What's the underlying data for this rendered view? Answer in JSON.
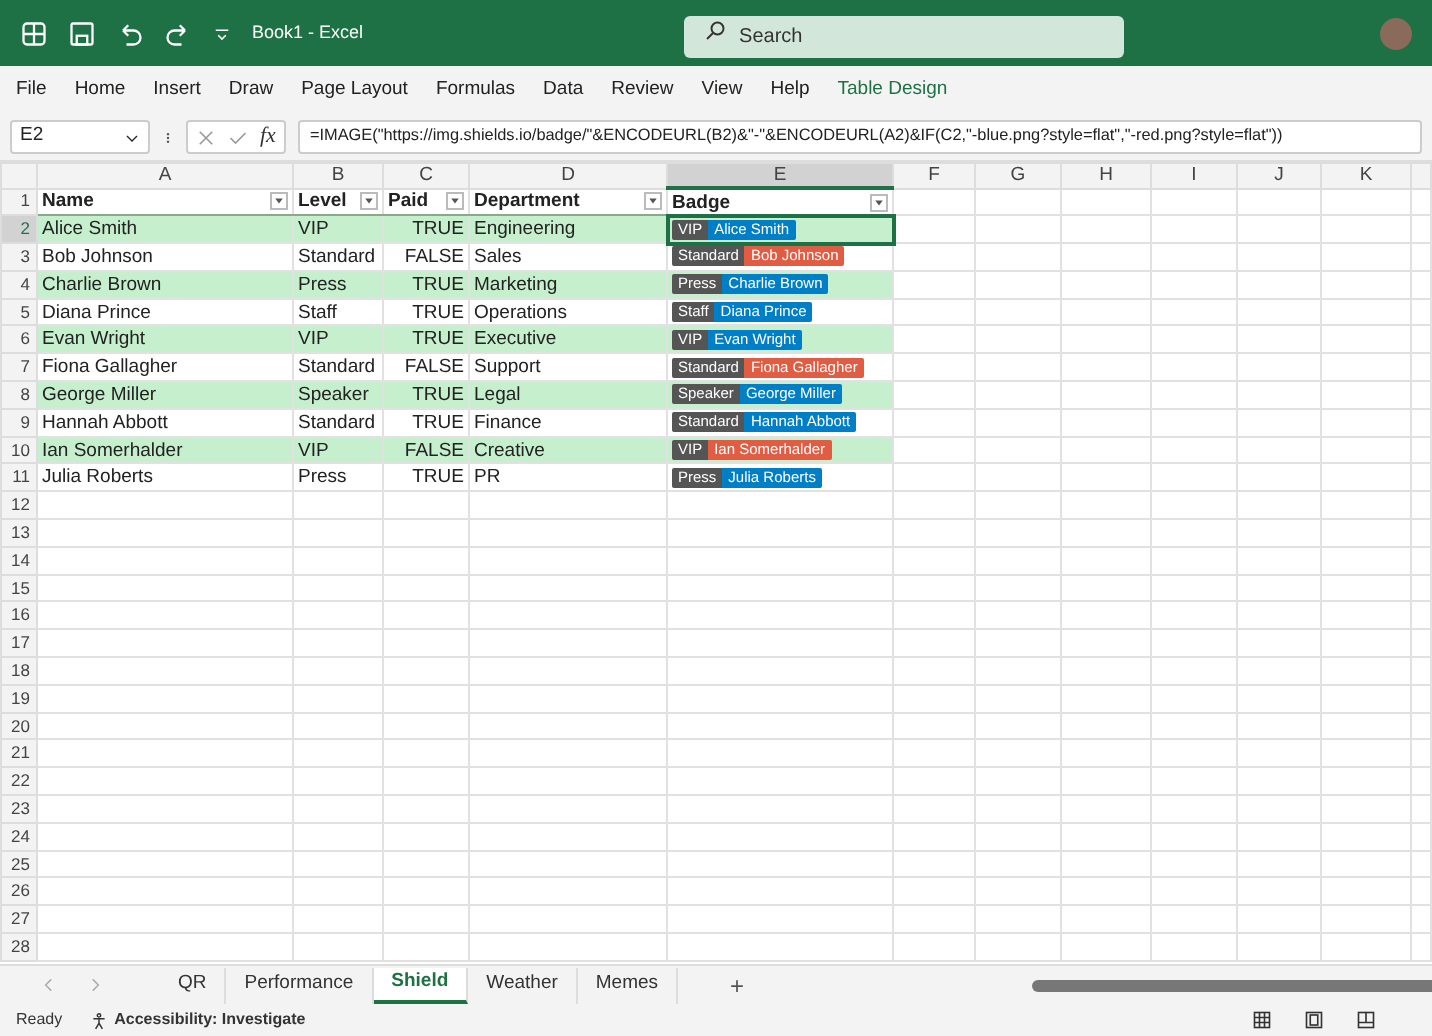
{
  "window": {
    "title": "Book1  -  Excel",
    "search": {
      "placeholder": "Search"
    }
  },
  "ribbon_tabs": [
    {
      "label": "File",
      "kind": "normal"
    },
    {
      "label": "Home",
      "kind": "normal"
    },
    {
      "label": "Insert",
      "kind": "normal"
    },
    {
      "label": "Draw",
      "kind": "normal"
    },
    {
      "label": "Page Layout",
      "kind": "normal"
    },
    {
      "label": "Formulas",
      "kind": "normal"
    },
    {
      "label": "Data",
      "kind": "normal"
    },
    {
      "label": "Review",
      "kind": "normal"
    },
    {
      "label": "View",
      "kind": "normal"
    },
    {
      "label": "Help",
      "kind": "normal"
    },
    {
      "label": "Table Design",
      "kind": "contextual"
    }
  ],
  "formula_bar": {
    "name_box": "E2",
    "fx": "fx",
    "formula": "=IMAGE(\"https://img.shields.io/badge/\"&ENCODEURL(B2)&\"-\"&ENCODEURL(A2)&IF(C2,\"-blue.png?style=flat\",\"-red.png?style=flat\"))"
  },
  "column_headers": [
    {
      "label": "A",
      "selected": false
    },
    {
      "label": "B",
      "selected": false
    },
    {
      "label": "C",
      "selected": false
    },
    {
      "label": "D",
      "selected": false
    },
    {
      "label": "E",
      "selected": true
    },
    {
      "label": "F",
      "selected": false
    },
    {
      "label": "G",
      "selected": false
    },
    {
      "label": "H",
      "selected": false
    },
    {
      "label": "I",
      "selected": false
    },
    {
      "label": "J",
      "selected": false
    },
    {
      "label": "K",
      "selected": false
    }
  ],
  "row_numbers": [
    {
      "label": "1",
      "selected": false
    },
    {
      "label": "2",
      "selected": true
    },
    {
      "label": "3",
      "selected": false
    },
    {
      "label": "4",
      "selected": false
    },
    {
      "label": "5",
      "selected": false
    },
    {
      "label": "6",
      "selected": false
    },
    {
      "label": "7",
      "selected": false
    },
    {
      "label": "8",
      "selected": false
    },
    {
      "label": "9",
      "selected": false
    },
    {
      "label": "10",
      "selected": false
    },
    {
      "label": "11",
      "selected": false
    },
    {
      "label": "12",
      "selected": false
    },
    {
      "label": "13",
      "selected": false
    },
    {
      "label": "14",
      "selected": false
    },
    {
      "label": "15",
      "selected": false
    },
    {
      "label": "16",
      "selected": false
    },
    {
      "label": "17",
      "selected": false
    },
    {
      "label": "18",
      "selected": false
    },
    {
      "label": "19",
      "selected": false
    },
    {
      "label": "20",
      "selected": false
    },
    {
      "label": "21",
      "selected": false
    },
    {
      "label": "22",
      "selected": false
    },
    {
      "label": "23",
      "selected": false
    },
    {
      "label": "24",
      "selected": false
    },
    {
      "label": "25",
      "selected": false
    },
    {
      "label": "26",
      "selected": false
    },
    {
      "label": "27",
      "selected": false
    },
    {
      "label": "28",
      "selected": false
    }
  ],
  "table": {
    "columns": [
      "Name",
      "Level",
      "Paid",
      "Department",
      "Badge"
    ],
    "rows": [
      {
        "name": "Alice Smith",
        "level": "VIP",
        "paid": "TRUE",
        "department": "Engineering",
        "badge": {
          "label": "VIP",
          "message": "Alice Smith",
          "color": "#007ec6"
        }
      },
      {
        "name": "Bob Johnson",
        "level": "Standard",
        "paid": "FALSE",
        "department": "Sales",
        "badge": {
          "label": "Standard",
          "message": "Bob Johnson",
          "color": "#e05d44"
        }
      },
      {
        "name": "Charlie Brown",
        "level": "Press",
        "paid": "TRUE",
        "department": "Marketing",
        "badge": {
          "label": "Press",
          "message": "Charlie Brown",
          "color": "#007ec6"
        }
      },
      {
        "name": "Diana Prince",
        "level": "Staff",
        "paid": "TRUE",
        "department": "Operations",
        "badge": {
          "label": "Staff",
          "message": "Diana Prince",
          "color": "#007ec6"
        }
      },
      {
        "name": "Evan Wright",
        "level": "VIP",
        "paid": "TRUE",
        "department": "Executive",
        "badge": {
          "label": "VIP",
          "message": "Evan Wright",
          "color": "#007ec6"
        }
      },
      {
        "name": "Fiona Gallagher",
        "level": "Standard",
        "paid": "FALSE",
        "department": "Support",
        "badge": {
          "label": "Standard",
          "message": "Fiona Gallagher",
          "color": "#e05d44"
        }
      },
      {
        "name": "George Miller",
        "level": "Speaker",
        "paid": "TRUE",
        "department": "Legal",
        "badge": {
          "label": "Speaker",
          "message": "George Miller",
          "color": "#007ec6"
        }
      },
      {
        "name": "Hannah Abbott",
        "level": "Standard",
        "paid": "TRUE",
        "department": "Finance",
        "badge": {
          "label": "Standard",
          "message": "Hannah Abbott",
          "color": "#007ec6"
        }
      },
      {
        "name": "Ian Somerhalder",
        "level": "VIP",
        "paid": "FALSE",
        "department": "Creative",
        "badge": {
          "label": "VIP",
          "message": "Ian Somerhalder",
          "color": "#e05d44"
        }
      },
      {
        "name": "Julia Roberts",
        "level": "Press",
        "paid": "TRUE",
        "department": "PR",
        "badge": {
          "label": "Press",
          "message": "Julia Roberts",
          "color": "#007ec6"
        }
      }
    ]
  },
  "sheet_tabs": [
    {
      "label": "QR",
      "selected": false
    },
    {
      "label": "Performance",
      "selected": false
    },
    {
      "label": "Shield",
      "selected": true
    },
    {
      "label": "Weather",
      "selected": false
    },
    {
      "label": "Memes",
      "selected": false
    }
  ],
  "add_sheet": "+",
  "status_bar": {
    "ready": "Ready",
    "accessibility": "Accessibility: Investigate"
  }
}
